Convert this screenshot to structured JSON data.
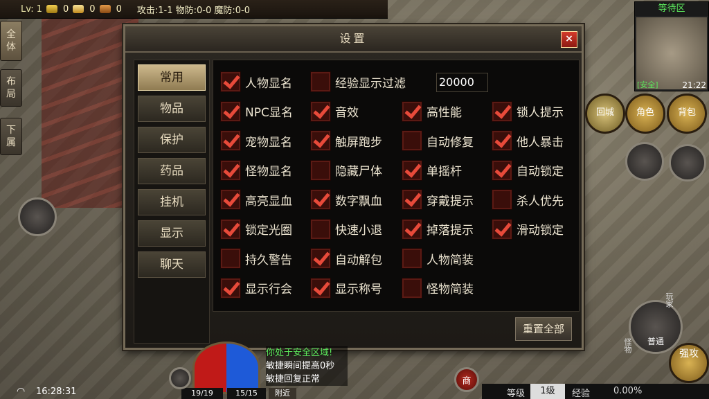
{
  "hud": {
    "level": "Lv: 1",
    "gold": "0",
    "ingot": "0",
    "tickets": "0",
    "stats": "攻击:1-1  物防:0-0  魔防:0-0"
  },
  "side_tabs": [
    "全体",
    "布局",
    "下属"
  ],
  "dialog": {
    "title": "设置",
    "close_label": "×",
    "menu": [
      "常用",
      "物品",
      "保护",
      "药品",
      "挂机",
      "显示",
      "聊天"
    ],
    "exp_filter_value": "20000",
    "reset_label": "重置全部",
    "options": [
      {
        "label": "人物显名",
        "checked": true
      },
      {
        "label": "经验显示过滤",
        "checked": false
      },
      {
        "label": "NPC显名",
        "checked": true
      },
      {
        "label": "音效",
        "checked": true
      },
      {
        "label": "高性能",
        "checked": true
      },
      {
        "label": "锁人提示",
        "checked": true
      },
      {
        "label": "宠物显名",
        "checked": true
      },
      {
        "label": "触屏跑步",
        "checked": true
      },
      {
        "label": "自动修复",
        "checked": false
      },
      {
        "label": "他人暴击",
        "checked": true
      },
      {
        "label": "怪物显名",
        "checked": true
      },
      {
        "label": "隐藏尸体",
        "checked": false
      },
      {
        "label": "单摇杆",
        "checked": true
      },
      {
        "label": "自动锁定",
        "checked": true
      },
      {
        "label": "高亮显血",
        "checked": true
      },
      {
        "label": "数字飘血",
        "checked": true
      },
      {
        "label": "穿戴提示",
        "checked": true
      },
      {
        "label": "杀人优先",
        "checked": false
      },
      {
        "label": "锁定光圈",
        "checked": true
      },
      {
        "label": "快速小退",
        "checked": false
      },
      {
        "label": "掉落提示",
        "checked": true
      },
      {
        "label": "滑动锁定",
        "checked": true
      },
      {
        "label": "持久警告",
        "checked": false
      },
      {
        "label": "自动解包",
        "checked": true
      },
      {
        "label": "人物简装",
        "checked": false
      },
      {
        "label": "显示行会",
        "checked": true
      },
      {
        "label": "显示称号",
        "checked": true
      },
      {
        "label": "怪物简装",
        "checked": false
      }
    ]
  },
  "minimap": {
    "zone": "等待区",
    "safe": "[安全]",
    "time": "21:22"
  },
  "right_buttons": {
    "return_city": "回城",
    "character": "角色",
    "bag": "背包"
  },
  "attack": {
    "mode": "普通",
    "player_label": "玩家",
    "monster_label": "怪物",
    "skill": "强攻"
  },
  "chat": [
    "你处于安全区域!",
    "敏捷瞬间提高0秒",
    "敏捷回复正常"
  ],
  "bottom": {
    "clock": "16:28:31",
    "hp": "19/19",
    "mp": "15/15",
    "nearby": "附近",
    "shop": "商",
    "level_label": "等级",
    "level_value": "1级",
    "exp_label": "经验",
    "exp_value": "0.00%"
  },
  "colors": {
    "check": "#e84a3a",
    "zone_text": "#5ce85c",
    "accent": "#cdb88c"
  }
}
